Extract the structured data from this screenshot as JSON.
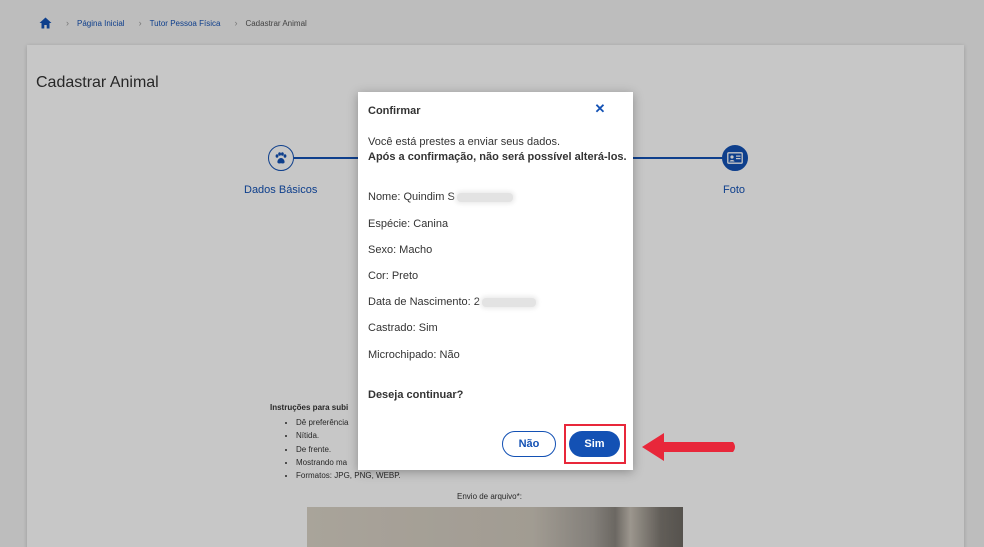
{
  "breadcrumb": {
    "home_icon": "home-icon",
    "items": [
      "Página Inicial",
      "Tutor Pessoa Física",
      "Cadastrar Animal"
    ]
  },
  "page": {
    "title": "Cadastrar Animal"
  },
  "stepper": {
    "steps": [
      {
        "label": "Dados Básicos",
        "icon": "paw-icon"
      },
      {
        "label": "Foto",
        "icon": "id-card-icon"
      }
    ]
  },
  "instructions": {
    "title": "Instruções para subi",
    "items": [
      "Dê preferência",
      "Nítida.",
      "De frente.",
      "Mostrando ma",
      "Formatos: JPG, PNG, WEBP."
    ],
    "upload_label": "Envio de arquivo*:"
  },
  "modal": {
    "title": "Confirmar",
    "close_icon": "close-icon",
    "intro": "Você está prestes a enviar seus dados.",
    "warning": "Após a confirmação, não será possível alterá-los.",
    "fields": [
      {
        "text": "Nome: Quindim S",
        "redacted": true
      },
      {
        "text": "Espécie: Canina",
        "redacted": false
      },
      {
        "text": "Sexo: Macho",
        "redacted": false
      },
      {
        "text": "Cor: Preto",
        "redacted": false
      },
      {
        "text": "Data de Nascimento: 2",
        "redacted": true
      },
      {
        "text": "Castrado: Sim",
        "redacted": false
      },
      {
        "text": "Microchipado: Não",
        "redacted": false
      }
    ],
    "question": "Deseja continuar?",
    "no_label": "Não",
    "yes_label": "Sim"
  },
  "colors": {
    "primary": "#1351b4",
    "highlight": "#e8273a"
  }
}
